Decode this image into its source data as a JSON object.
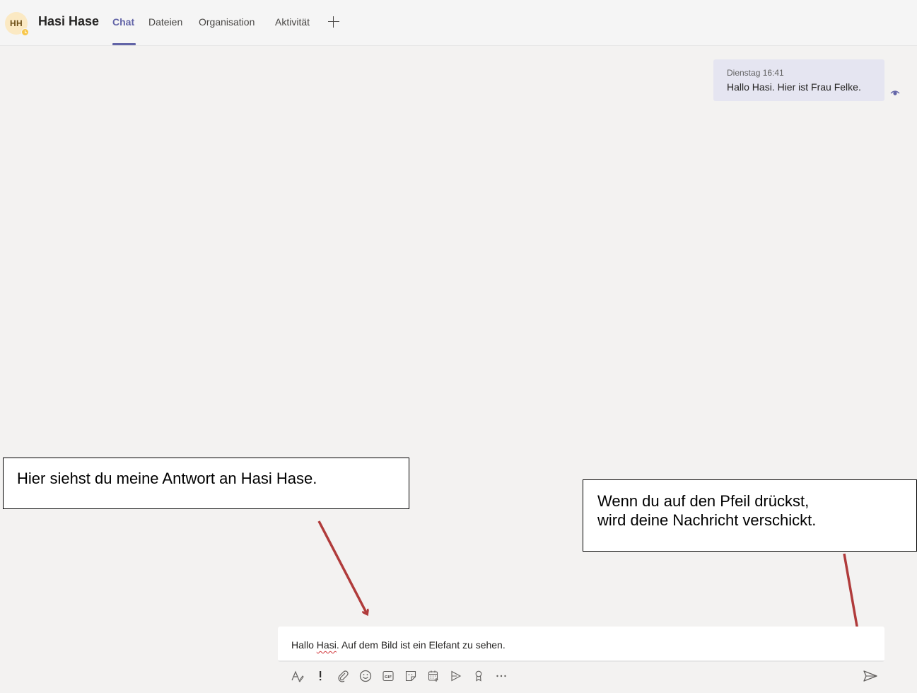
{
  "header": {
    "avatar_initials": "HH",
    "contact_name": "Hasi Hase",
    "tabs": [
      {
        "label": "Chat",
        "active": true
      },
      {
        "label": "Dateien",
        "active": false
      },
      {
        "label": "Organisation",
        "active": false
      },
      {
        "label": "Aktivität",
        "active": false
      }
    ],
    "add_tab_icon": "plus-icon"
  },
  "messages": [
    {
      "time": "Dienstag 16:41",
      "text": "Hallo Hasi. Hier ist Frau Felke.",
      "status_icon": "eye-icon"
    }
  ],
  "annotations": {
    "callout_answer": "Hier siehst du meine Antwort an Hasi Hase.",
    "callout_send_line1": "Wenn du auf den Pfeil drückst,",
    "callout_send_line2": "wird deine Nachricht verschickt.",
    "arrow_color": "#b03b3b"
  },
  "compose": {
    "text_before": "Hallo ",
    "text_misspelled": "Hasi",
    "text_after": ". Auf dem Bild ist ein Elefant zu sehen."
  },
  "toolbar": {
    "icons": [
      "format-icon",
      "important-icon",
      "attach-icon",
      "emoji-icon",
      "gif-icon",
      "sticker-icon",
      "schedule-meeting-icon",
      "stream-icon",
      "praise-icon",
      "more-icon"
    ],
    "send_icon": "send-icon"
  },
  "colors": {
    "accent": "#6264a7",
    "bubble": "#e5e5f1",
    "background": "#f3f2f1"
  }
}
